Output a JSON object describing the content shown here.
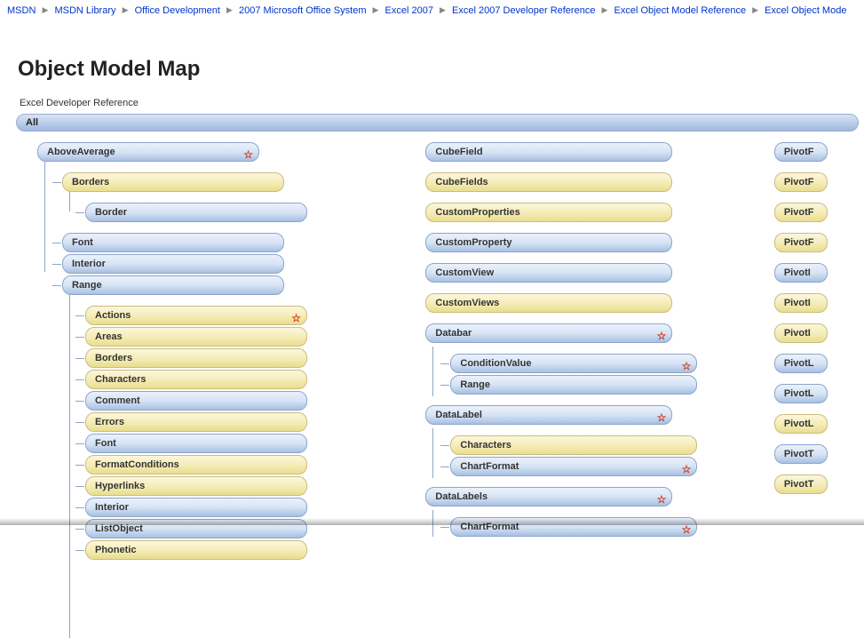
{
  "breadcrumb": {
    "items": [
      "MSDN",
      "MSDN Library",
      "Office Development",
      "2007 Microsoft Office System",
      "Excel 2007",
      "Excel 2007 Developer Reference",
      "Excel Object Model Reference",
      "Excel Object Mode"
    ]
  },
  "page": {
    "title": "Object Model Map",
    "subtitle": "Excel Developer Reference",
    "all_label": "All"
  },
  "colA": {
    "n0": {
      "label": "AboveAverage",
      "star": "☆"
    },
    "n0_0": {
      "label": "Borders"
    },
    "n0_0_0": {
      "label": "Border"
    },
    "n0_1": {
      "label": "Font"
    },
    "n0_2": {
      "label": "Interior"
    },
    "n0_3": {
      "label": "Range"
    },
    "n0_3_0": {
      "label": "Actions",
      "star": "☆"
    },
    "n0_3_1": {
      "label": "Areas"
    },
    "n0_3_2": {
      "label": "Borders"
    },
    "n0_3_3": {
      "label": "Characters"
    },
    "n0_3_4": {
      "label": "Comment"
    },
    "n0_3_5": {
      "label": "Errors"
    },
    "n0_3_6": {
      "label": "Font"
    },
    "n0_3_7": {
      "label": "FormatConditions"
    },
    "n0_3_8": {
      "label": "Hyperlinks"
    },
    "n0_3_9": {
      "label": "Interior"
    },
    "n0_3_10": {
      "label": "ListObject"
    },
    "n0_3_11": {
      "label": "Phonetic"
    }
  },
  "colB": {
    "n0": {
      "label": "CubeField"
    },
    "n1": {
      "label": "CubeFields"
    },
    "n2": {
      "label": "CustomProperties"
    },
    "n3": {
      "label": "CustomProperty"
    },
    "n4": {
      "label": "CustomView"
    },
    "n5": {
      "label": "CustomViews"
    },
    "n6": {
      "label": "Databar",
      "star": "☆"
    },
    "n6_0": {
      "label": "ConditionValue",
      "star": "☆"
    },
    "n6_1": {
      "label": "Range"
    },
    "n7": {
      "label": "DataLabel",
      "star": "☆"
    },
    "n7_0": {
      "label": "Characters"
    },
    "n7_1": {
      "label": "ChartFormat",
      "star": "☆"
    },
    "n8": {
      "label": "DataLabels",
      "star": "☆"
    },
    "n8_0": {
      "label": "ChartFormat",
      "star": "☆"
    }
  },
  "colC": {
    "n0": {
      "label": "PivotF"
    },
    "n1": {
      "label": "PivotF"
    },
    "n2": {
      "label": "PivotF"
    },
    "n3": {
      "label": "PivotF"
    },
    "n4": {
      "label": "PivotI"
    },
    "n5": {
      "label": "PivotI"
    },
    "n6": {
      "label": "PivotI"
    },
    "n7": {
      "label": "PivotL"
    },
    "n8": {
      "label": "PivotL"
    },
    "n9": {
      "label": "PivotL"
    },
    "n10": {
      "label": "PivotT"
    },
    "n11": {
      "label": "PivotT"
    }
  }
}
